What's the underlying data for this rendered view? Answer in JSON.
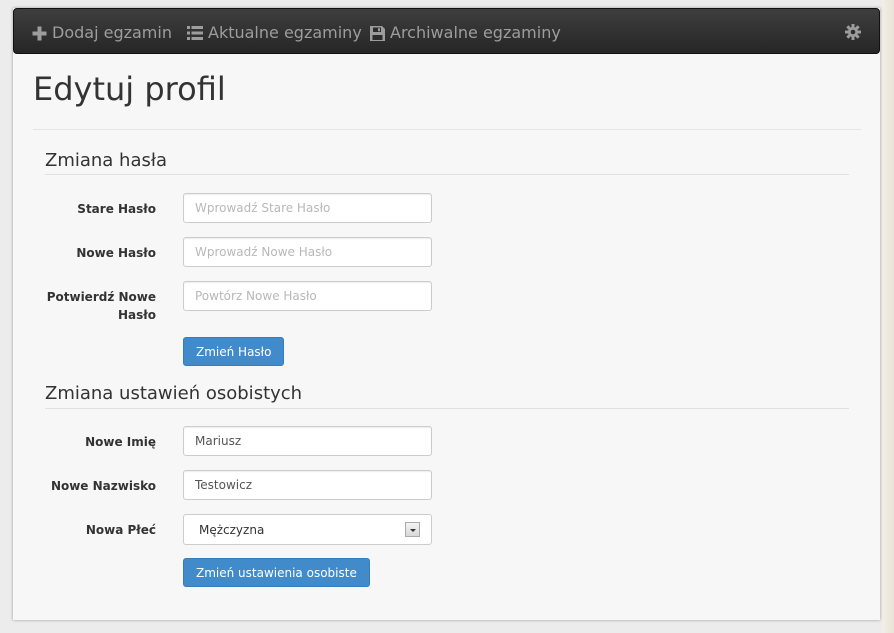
{
  "navbar": {
    "items": [
      {
        "label": "Dodaj egzamin",
        "icon": "plus-icon"
      },
      {
        "label": "Aktualne egzaminy",
        "icon": "list-icon"
      },
      {
        "label": "Archiwalne egzaminy",
        "icon": "save-icon"
      }
    ],
    "settings_icon": "gear-icon"
  },
  "page": {
    "title": "Edytuj profil"
  },
  "password_section": {
    "legend": "Zmiana hasła",
    "old_label": "Stare Hasło",
    "old_placeholder": "Wprowadź Stare Hasło",
    "new_label": "Nowe Hasło",
    "new_placeholder": "Wprowadź Nowe Hasło",
    "confirm_label_line1": "Potwierdź Nowe",
    "confirm_label_line2": "Hasło",
    "confirm_placeholder": "Powtórz Nowe Hasło",
    "submit_label": "Zmień Hasło"
  },
  "personal_section": {
    "legend": "Zmiana ustawień osobistych",
    "first_name_label": "Nowe Imię",
    "first_name_value": "Mariusz",
    "last_name_label": "Nowe Nazwisko",
    "last_name_value": "Testowicz",
    "gender_label": "Nowa Płeć",
    "gender_selected": "Mężczyzna",
    "submit_label": "Zmień ustawienia osobiste"
  },
  "colors": {
    "navbar_bg": "#2d2d2d",
    "nav_text": "#9d9d9d",
    "primary_button": "#428bca"
  }
}
